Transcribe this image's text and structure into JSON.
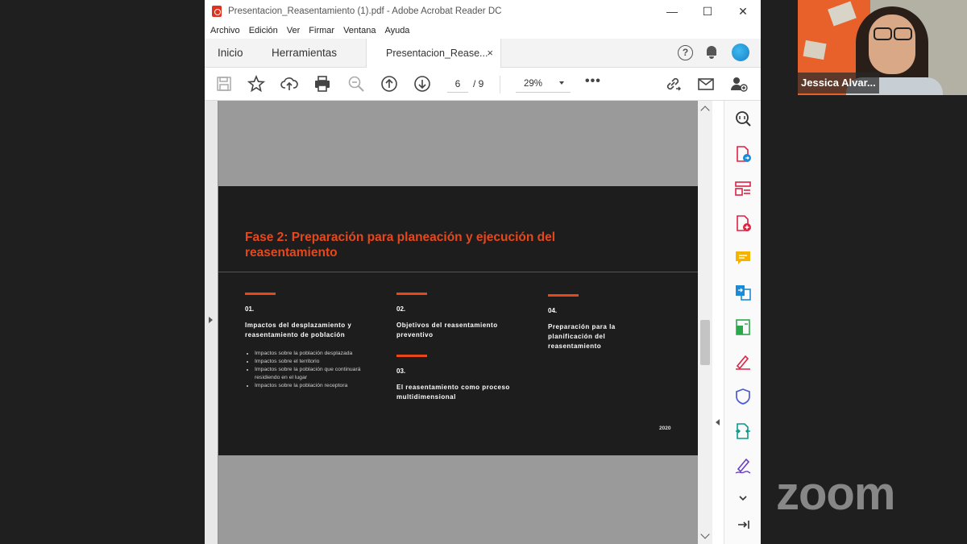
{
  "window": {
    "title": "Presentacion_Reasentamiento (1).pdf - Adobe Acrobat Reader DC",
    "minimize": "—",
    "maximize": "☐",
    "close": "✕"
  },
  "menu": [
    "Archivo",
    "Edición",
    "Ver",
    "Firmar",
    "Ventana",
    "Ayuda"
  ],
  "tabs": {
    "inicio": "Inicio",
    "herramientas": "Herramientas",
    "document": "Presentacion_Rease...",
    "close": "×"
  },
  "tab_right": {
    "help": "?"
  },
  "toolbar": {
    "page_current": "6",
    "page_total": "/ 9",
    "zoom": "29%",
    "more": "•••"
  },
  "slide": {
    "title": "Fase 2: Preparación para planeación y ejecución del reasentamiento",
    "accent_color": "#e8471a",
    "sections": [
      {
        "num": "01.",
        "heading": "Impactos del desplazamiento y reasentamiento de población",
        "bullets": [
          "Impactos sobre la población desplazada",
          "Impactos sobre el territorio",
          "Impactos sobre la población que continuará residiendo en el lugar",
          "Impactos sobre la población receptora"
        ]
      },
      {
        "num": "02.",
        "heading": "Objetivos del reasentamiento preventivo"
      },
      {
        "num": "03.",
        "heading": "El reasentamiento como proceso multidimensional"
      },
      {
        "num": "04.",
        "heading": "Preparación para la planificación del reasentamiento"
      }
    ],
    "year": "2020"
  },
  "right_tools": [
    "zoom-search-icon",
    "export-pdf-icon",
    "organize-pages-icon",
    "create-pdf-icon",
    "comment-icon",
    "combine-files-icon",
    "scan-icon",
    "fill-sign-icon",
    "protect-icon",
    "compress-icon",
    "sign-icon",
    "expand-down-icon",
    "panel-collapse-icon"
  ],
  "participant": {
    "name": "Jessica Alvar..."
  },
  "zoom_logo": "zoom"
}
